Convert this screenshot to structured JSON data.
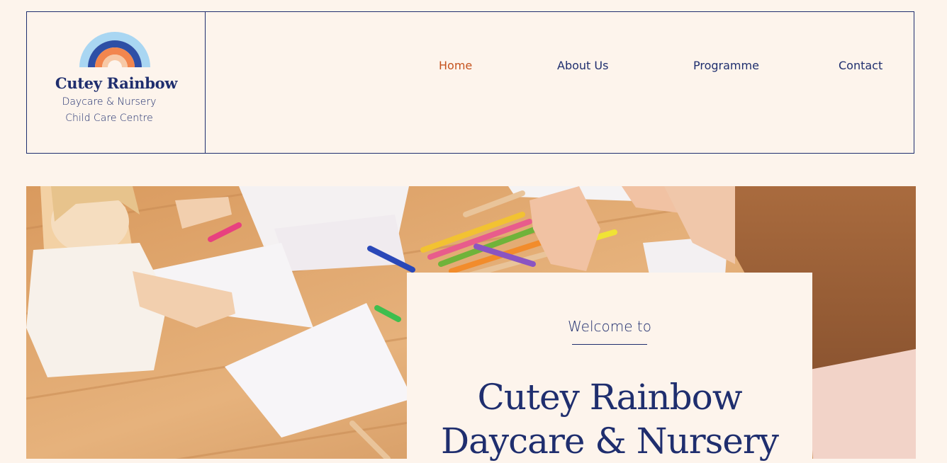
{
  "brand": {
    "name": "Cutey Rainbow",
    "subtitle_line1": "Daycare & Nursery",
    "subtitle_line2": "Child Care Centre",
    "logo_icon": "rainbow-icon"
  },
  "nav": {
    "items": [
      {
        "label": "Home",
        "active": true
      },
      {
        "label": "About Us",
        "active": false
      },
      {
        "label": "Programme",
        "active": false
      },
      {
        "label": "Contact",
        "active": false
      }
    ]
  },
  "hero": {
    "image": "children-drawing-at-table-photo",
    "welcome_text": "Welcome to",
    "title_line1": "Cutey Rainbow",
    "title_line2": "Daycare & Nursery"
  },
  "colors": {
    "background": "#FDF4EC",
    "navy": "#1F2E6E",
    "accent": "#C5531F",
    "rainbow": [
      "#A9D6F2",
      "#2E4FA6",
      "#F2864E",
      "#F7C9A6"
    ]
  }
}
